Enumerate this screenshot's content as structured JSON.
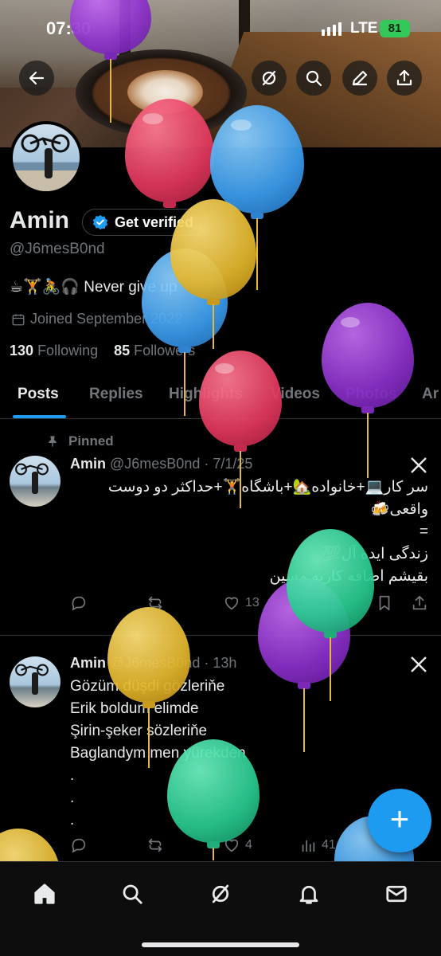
{
  "status_bar": {
    "time": "07:30",
    "network": "LTE",
    "battery": "81"
  },
  "header": {
    "back_icon": "arrow-left-icon",
    "actions": [
      "grok-icon",
      "search-icon",
      "edit-icon",
      "share-icon"
    ]
  },
  "profile": {
    "name": "Amin",
    "verify_label": "Get verified",
    "handle": "@J6mesB0nd",
    "bio": "☕🏋🚴🎧 Never give up",
    "joined": "Joined September 2022",
    "following_count": "130",
    "following_label": "Following",
    "followers_count": "85",
    "followers_label": "Followers"
  },
  "tabs": [
    "Posts",
    "Replies",
    "Highlights",
    "Videos",
    "Photos",
    "Ar"
  ],
  "posts": [
    {
      "pinned_label": "Pinned",
      "name": "Amin",
      "handle_time": "@J6mesB0nd · 7/1/25",
      "lines": [
        "سر کار💻+خانواده🏡+باشگاه🏋+حداکثر دو دوست",
        "واقعی🍻",
        "=",
        "زندگی ایده آل💯",
        "بقیشم اضافه کاریه مسین"
      ],
      "likes": "13"
    },
    {
      "name": "Amin",
      "handle_time": "@J6mesB0nd · 13h",
      "lines": [
        "Gözüm düşdi gözleriňe",
        "Erik boldum elimde",
        "Şirin-şeker sözleriňe",
        "Baglandym men yürekden",
        ".",
        ".",
        "."
      ],
      "likes": "4",
      "views": "41"
    }
  ],
  "fab_label": "+",
  "bottom_nav": [
    "home-icon",
    "search-icon",
    "grok-icon",
    "notifications-icon",
    "messages-icon"
  ],
  "colors": {
    "accent": "#1d9bf0",
    "background": "#000000",
    "muted": "#71767b"
  }
}
